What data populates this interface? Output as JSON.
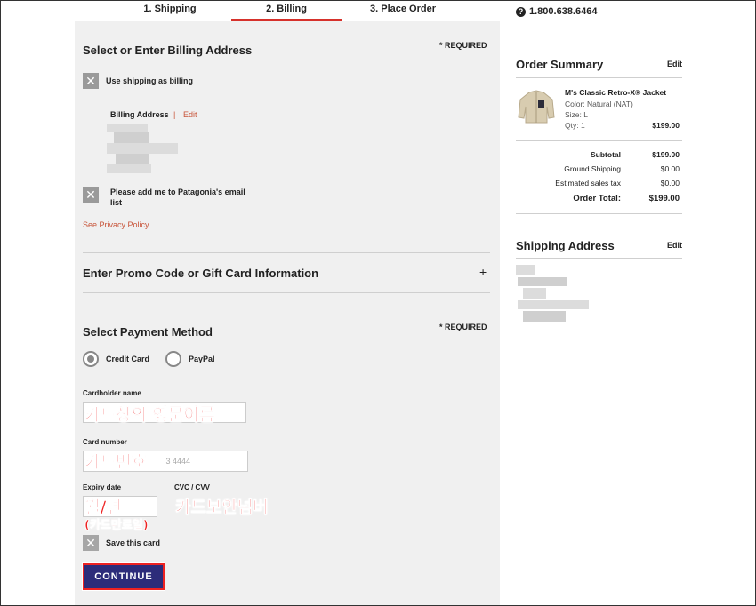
{
  "steps": [
    {
      "label": "1. Shipping"
    },
    {
      "label": "2. Billing"
    },
    {
      "label": "3. Place Order"
    }
  ],
  "phone": {
    "icon": "question-icon",
    "number": "1.800.638.6464"
  },
  "billing": {
    "title": "Select or Enter Billing Address",
    "required": "* REQUIRED",
    "use_shipping_label": "Use shipping as billing",
    "billing_address_label": "Billing Address",
    "separator": "|",
    "edit_label": "Edit",
    "email_label": "Please add me to Patagonia's email list",
    "privacy_link": "See Privacy Policy"
  },
  "promo": {
    "title": "Enter Promo Code or Gift Card Information",
    "toggle": "+"
  },
  "payment": {
    "title": "Select Payment Method",
    "required": "* REQUIRED",
    "options": [
      {
        "label": "Credit Card",
        "selected": true
      },
      {
        "label": "PayPal",
        "selected": false
      }
    ],
    "cardholder_label": "Cardholder name",
    "card_number_label": "Card number",
    "card_number_placeholder": "3 4444",
    "expiry_label": "Expiry date",
    "cvc_label": "CVC / CVV",
    "save_card_label": "Save this card",
    "continue_label": "CONTINUE"
  },
  "annotations": {
    "cardholder": "카드상의 영문이름",
    "card_number": "카드번호",
    "expiry": "월/년",
    "expiry_note": "(카드만료일)",
    "cvc": "카드보안넘버"
  },
  "summary": {
    "title": "Order Summary",
    "edit": "Edit",
    "item": {
      "name": "M's Classic Retro-X® Jacket",
      "color": "Color: Natural (NAT)",
      "size": "Size: L",
      "qty": "Qty: 1",
      "price": "$199.00"
    },
    "rows": [
      {
        "label": "Subtotal",
        "value": "$199.00"
      },
      {
        "label": "Ground Shipping",
        "value": "$0.00"
      },
      {
        "label": "Estimated sales tax",
        "value": "$0.00"
      }
    ],
    "total_label": "Order Total:",
    "total_value": "$199.00"
  },
  "shipping": {
    "title": "Shipping Address",
    "edit": "Edit"
  },
  "colors": {
    "accent": "#d6312b",
    "button": "#2d2c7a",
    "panel": "#f0f0f0",
    "annotation": "#ee2222"
  }
}
